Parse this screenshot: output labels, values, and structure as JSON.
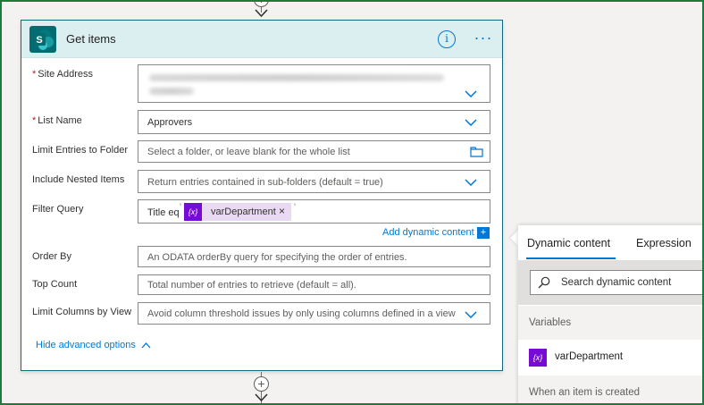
{
  "action": {
    "title": "Get items",
    "info_icon": "info-icon",
    "more_icon": "more-options-icon"
  },
  "fields": {
    "site_address": {
      "label": "Site Address",
      "required": true,
      "value": ""
    },
    "list_name": {
      "label": "List Name",
      "required": true,
      "value": "Approvers"
    },
    "limit_folder": {
      "label": "Limit Entries to Folder",
      "placeholder": "Select a folder, or leave blank for the whole list"
    },
    "nested_items": {
      "label": "Include Nested Items",
      "placeholder": "Return entries contained in sub-folders (default = true)"
    },
    "filter_query": {
      "label": "Filter Query",
      "prefix": "Title eq",
      "token_label": "varDepartment",
      "token_icon": "{x}",
      "token_remove": "×",
      "quote": "'"
    },
    "add_dynamic_content": "Add dynamic content",
    "add_dynamic_icon": "+",
    "order_by": {
      "label": "Order By",
      "placeholder": "An ODATA orderBy query for specifying the order of entries."
    },
    "top_count": {
      "label": "Top Count",
      "placeholder": "Total number of entries to retrieve (default = all)."
    },
    "limit_columns": {
      "label": "Limit Columns by View",
      "placeholder": "Avoid column threshold issues by only using columns defined in a view"
    },
    "hide_advanced": "Hide advanced options"
  },
  "required_marker": "*",
  "connector_plus": "+",
  "dynamic_panel": {
    "tabs": [
      "Dynamic content",
      "Expression"
    ],
    "active_tab": "Dynamic content",
    "search_placeholder": "Search dynamic content",
    "sections": [
      {
        "title": "Variables",
        "items": [
          {
            "icon": "{x}",
            "label": "varDepartment"
          }
        ]
      },
      {
        "title": "When an item is created",
        "items": []
      }
    ]
  },
  "colors": {
    "accent": "#0078d4",
    "header_bg": "#dceff0",
    "sharepoint": "#036c70",
    "variable_purple": "#770bd6",
    "token_bg": "#ead9f3",
    "frame_green": "#1b7a3c"
  }
}
